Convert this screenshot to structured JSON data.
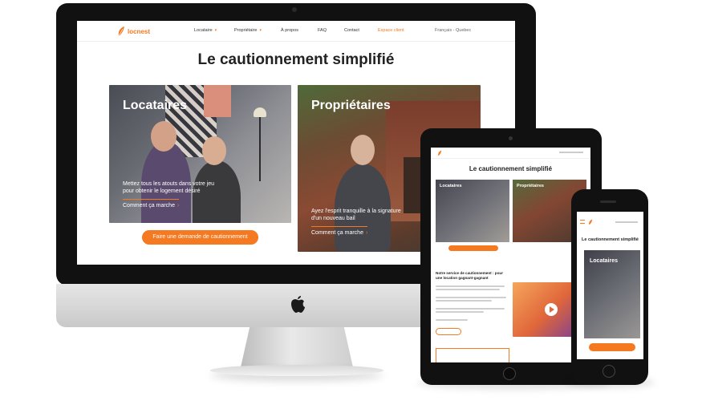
{
  "brand": {
    "name": "locnest",
    "accent": "#f47920"
  },
  "nav": {
    "items": [
      "Locataire",
      "Propriétaire",
      "À propos",
      "FAQ",
      "Contact"
    ],
    "client_link": "Espace client",
    "language": "Français - Quebec"
  },
  "hero": {
    "title": "Le cautionnement simplifié"
  },
  "cards": {
    "tenants": {
      "title": "Locataires",
      "description_line1": "Mettez tous les atouts dans votre jeu",
      "description_line2": "pour obtenir le logement désiré",
      "link": "Comment ça marche"
    },
    "owners": {
      "title": "Propriétaires",
      "description_line1": "Ayez l'esprit tranquille à la signature",
      "description_line2": "d'un nouveau bail",
      "link": "Comment ça marche"
    }
  },
  "cta": {
    "label": "Faire une demande de cautionnement"
  },
  "tablet": {
    "title": "Le cautionnement simplifié",
    "card1": "Locataires",
    "card2": "Propriétaires",
    "section_title_line1": "Notre service de cautionnement : pour",
    "section_title_line2": "une location gagnant-gagnant"
  },
  "phone": {
    "title": "Le cautionnement simplifié",
    "card": "Locataires"
  },
  "icons": {
    "apple": "apple-logo-icon",
    "logo": "leaf-logo-icon",
    "play": "play-icon"
  }
}
